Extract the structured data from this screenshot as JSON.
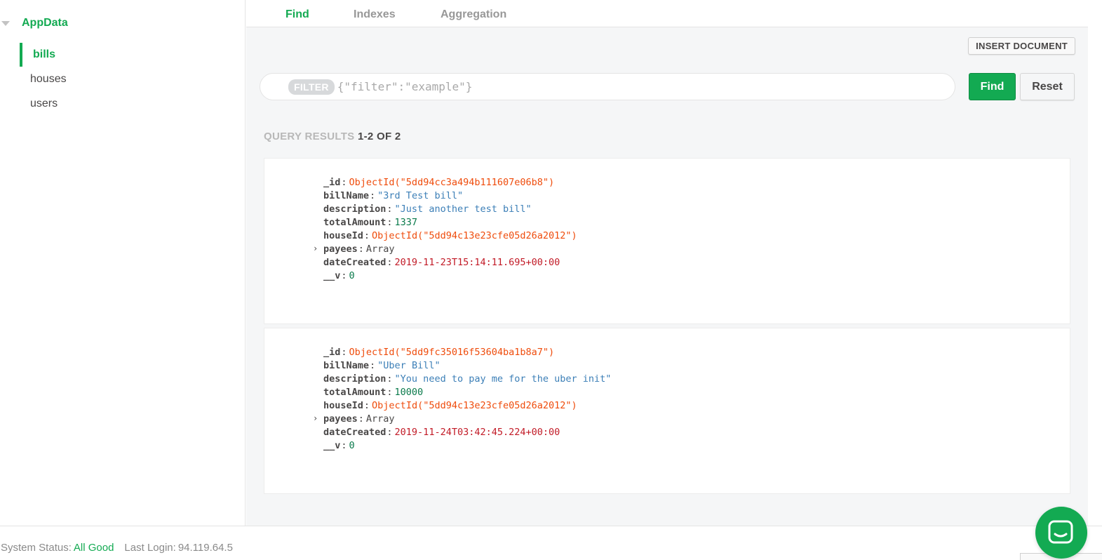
{
  "sidebar": {
    "database": "AppData",
    "collections": [
      {
        "label": "bills",
        "active": true
      },
      {
        "label": "houses",
        "active": false
      },
      {
        "label": "users",
        "active": false
      }
    ]
  },
  "tabs": [
    {
      "label": "Find",
      "active": true
    },
    {
      "label": "Indexes",
      "active": false
    },
    {
      "label": "Aggregation",
      "active": false
    }
  ],
  "toolbar": {
    "insert_label": "INSERT DOCUMENT",
    "filter_badge": "FILTER",
    "filter_placeholder": "{\"filter\":\"example\"}",
    "filter_value": "",
    "find_label": "Find",
    "reset_label": "Reset"
  },
  "results": {
    "label": "QUERY RESULTS",
    "count": "1-2 OF 2"
  },
  "documents": [
    {
      "fields": [
        {
          "key": "_id",
          "value": "ObjectId(\"5dd94cc3a494b111607e06b8\")",
          "type": "oid"
        },
        {
          "key": "billName",
          "value": "\"3rd Test bill\"",
          "type": "str"
        },
        {
          "key": "description",
          "value": "\"Just another test bill\"",
          "type": "str"
        },
        {
          "key": "totalAmount",
          "value": "1337",
          "type": "num"
        },
        {
          "key": "houseId",
          "value": "ObjectId(\"5dd94c13e23cfe05d26a2012\")",
          "type": "oid"
        },
        {
          "key": "payees",
          "value": "Array",
          "type": "arr"
        },
        {
          "key": "dateCreated",
          "value": "2019-11-23T15:14:11.695+00:00",
          "type": "date"
        },
        {
          "key": "__v",
          "value": "0",
          "type": "num"
        }
      ]
    },
    {
      "fields": [
        {
          "key": "_id",
          "value": "ObjectId(\"5dd9fc35016f53604ba1b8a7\")",
          "type": "oid"
        },
        {
          "key": "billName",
          "value": "\"Uber Bill\"",
          "type": "str"
        },
        {
          "key": "description",
          "value": "\"You need to pay me for the uber init\"",
          "type": "str"
        },
        {
          "key": "totalAmount",
          "value": "10000",
          "type": "num"
        },
        {
          "key": "houseId",
          "value": "ObjectId(\"5dd94c13e23cfe05d26a2012\")",
          "type": "oid"
        },
        {
          "key": "payees",
          "value": "Array",
          "type": "arr"
        },
        {
          "key": "dateCreated",
          "value": "2019-11-24T03:42:45.224+00:00",
          "type": "date"
        },
        {
          "key": "__v",
          "value": "0",
          "type": "num"
        }
      ]
    }
  ],
  "footer": {
    "status_label": "System Status:",
    "status_value": "All Good",
    "login_label": "Last Login:",
    "login_value": "94.119.64.5"
  },
  "colors": {
    "accent": "#13aa52",
    "oid": "#ef4c0c",
    "string": "#3c7fb7",
    "number": "#0a7a4b",
    "date": "#c21b27"
  }
}
